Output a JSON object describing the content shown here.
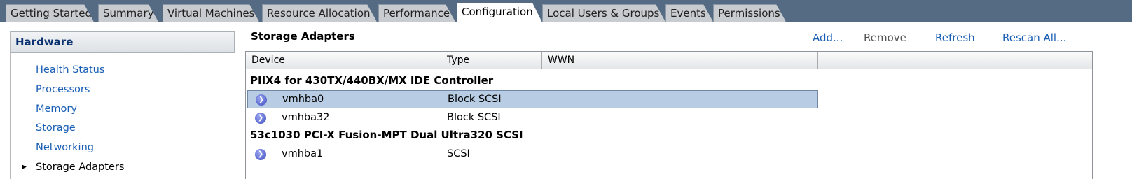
{
  "tabs": [
    {
      "label": "Getting Started",
      "active": false
    },
    {
      "label": "Summary",
      "active": false
    },
    {
      "label": "Virtual Machines",
      "active": false
    },
    {
      "label": "Resource Allocation",
      "active": false
    },
    {
      "label": "Performance",
      "active": false
    },
    {
      "label": "Configuration",
      "active": true
    },
    {
      "label": "Local Users & Groups",
      "active": false
    },
    {
      "label": "Events",
      "active": false
    },
    {
      "label": "Permissions",
      "active": false
    }
  ],
  "sidebar": {
    "header": "Hardware",
    "items": [
      {
        "label": "Health Status"
      },
      {
        "label": "Processors"
      },
      {
        "label": "Memory"
      },
      {
        "label": "Storage"
      },
      {
        "label": "Networking"
      },
      {
        "label": "Storage Adapters",
        "selected": true
      }
    ]
  },
  "main": {
    "title": "Storage Adapters",
    "toolbar": {
      "add": "Add...",
      "remove": "Remove",
      "refresh": "Refresh",
      "rescan": "Rescan All..."
    },
    "table": {
      "columns": [
        "Device",
        "Type",
        "WWN",
        ""
      ],
      "groups": [
        {
          "name": "PIIX4 for 430TX/440BX/MX IDE Controller",
          "rows": [
            {
              "device": "vmhba0",
              "type": "Block SCSI",
              "wwn": "",
              "selected": true
            },
            {
              "device": "vmhba32",
              "type": "Block SCSI",
              "wwn": "",
              "selected": false
            }
          ]
        },
        {
          "name": "53c1030 PCI-X Fusion-MPT Dual Ultra320 SCSI",
          "rows": [
            {
              "device": "vmhba1",
              "type": "SCSI",
              "wwn": "",
              "selected": false
            }
          ]
        }
      ]
    }
  },
  "icons": {
    "adapter": "storage-adapter-icon",
    "expand": "triangle-right-icon"
  },
  "colors": {
    "tabbar_bg": "#556b84",
    "link": "#1a5fb4",
    "selection": "#b8cde4",
    "header_text": "#0c3270"
  }
}
